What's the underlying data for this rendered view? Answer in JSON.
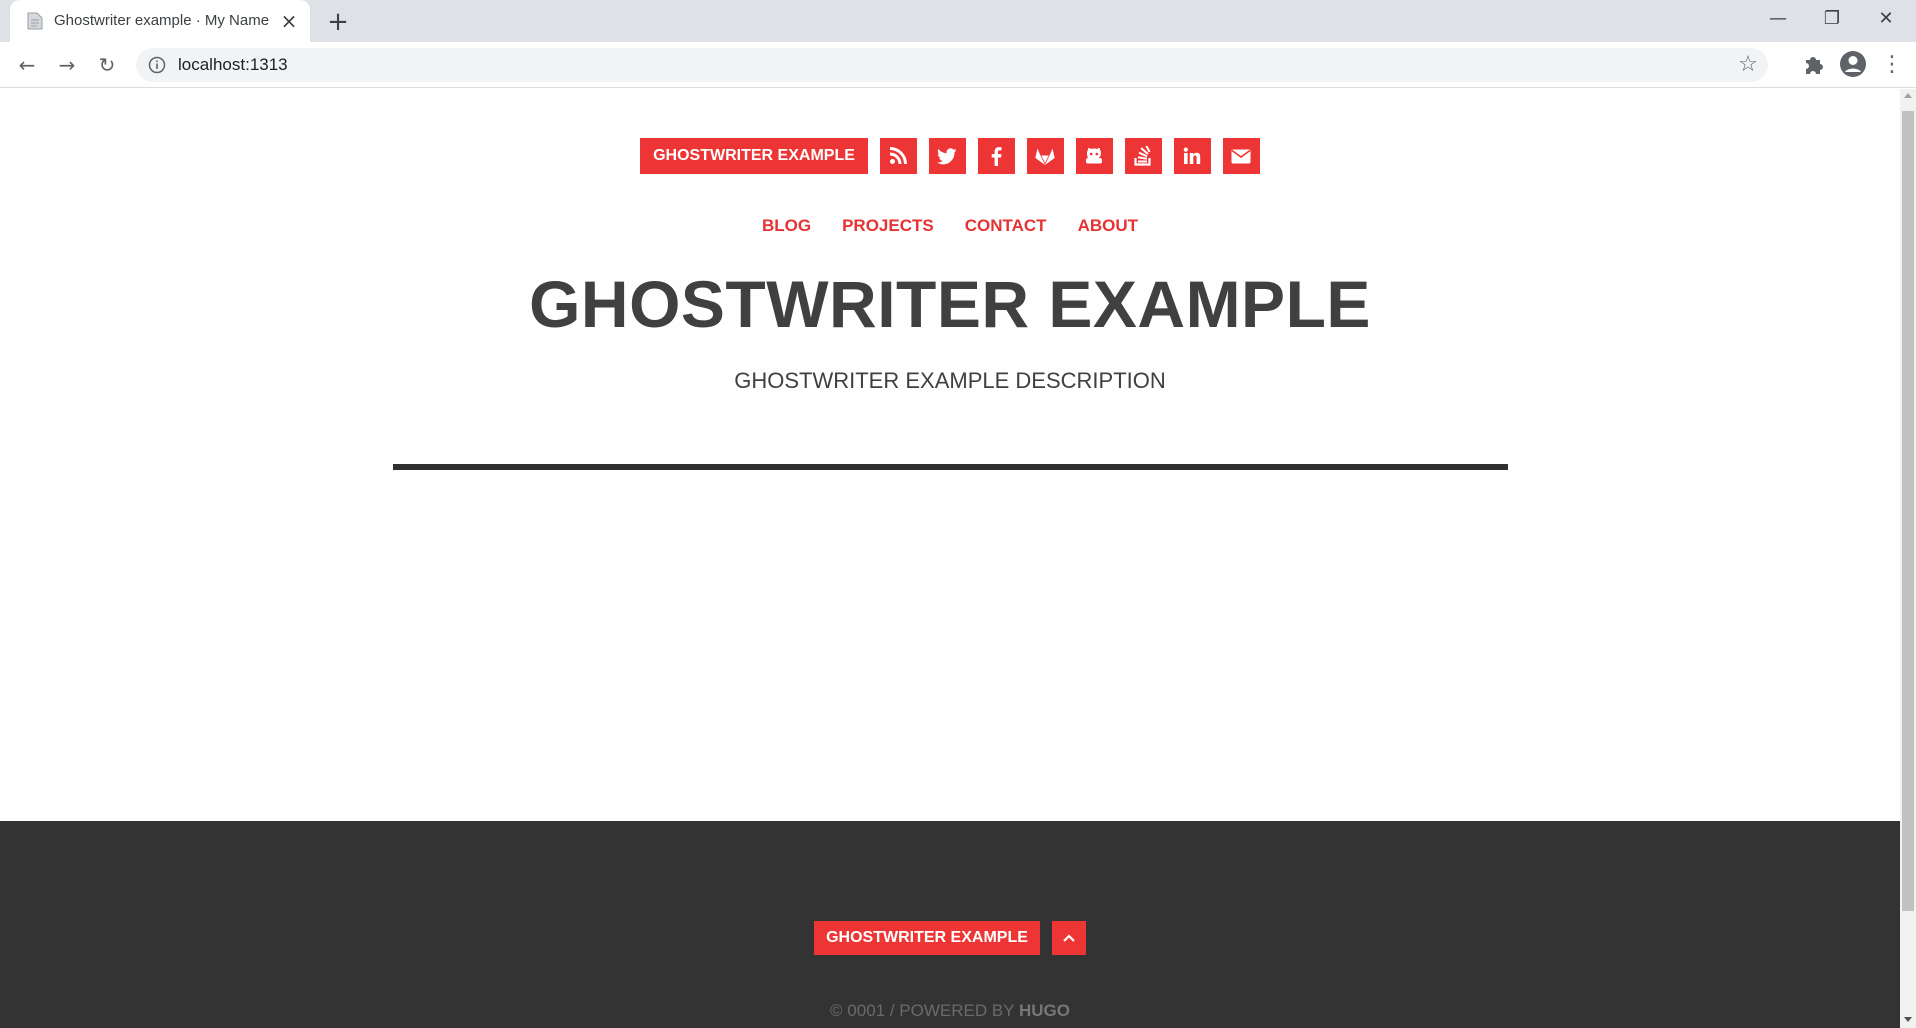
{
  "browser": {
    "tab_title": "Ghostwriter example · My Name",
    "url": "localhost:1313",
    "window_controls": {
      "minimize": "—",
      "maximize": "❐",
      "close": "✕"
    },
    "new_tab_icon": "plus-icon"
  },
  "site": {
    "brand": "GHOSTWRITER EXAMPLE",
    "social_icons": [
      "rss-icon",
      "twitter-icon",
      "facebook-icon",
      "gitlab-icon",
      "github-icon",
      "stackoverflow-icon",
      "linkedin-icon",
      "email-icon"
    ],
    "nav": [
      {
        "label": "BLOG"
      },
      {
        "label": "PROJECTS"
      },
      {
        "label": "CONTACT"
      },
      {
        "label": "ABOUT"
      }
    ],
    "title": "GHOSTWRITER EXAMPLE",
    "description": "GHOSTWRITER EXAMPLE DESCRIPTION"
  },
  "footer": {
    "brand": "GHOSTWRITER EXAMPLE",
    "copyright_prefix": "© 0001 / POWERED BY",
    "copyright_link": "HUGO"
  },
  "colors": {
    "accent": "#ee3535",
    "title_text": "#404040",
    "footer_bg": "#333333"
  }
}
